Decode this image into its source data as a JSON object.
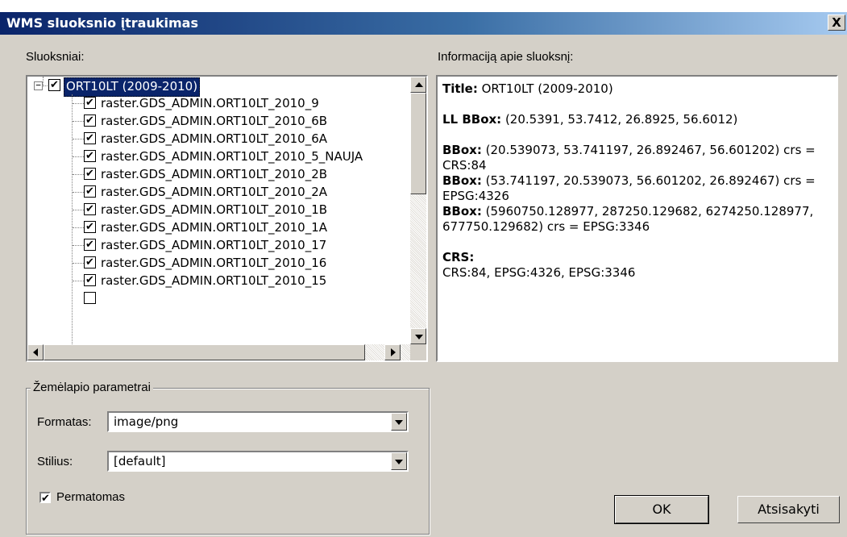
{
  "window": {
    "title": "WMS sluoksnio įtraukimas",
    "close_label": "X"
  },
  "layers": {
    "label": "Sluoksniai:",
    "root": {
      "label": "ORT10LT (2009-2010)",
      "checked": "✔",
      "expander": "−"
    },
    "items": [
      "raster.GDS_ADMIN.ORT10LT_2010_9",
      "raster.GDS_ADMIN.ORT10LT_2010_6B",
      "raster.GDS_ADMIN.ORT10LT_2010_6A",
      "raster.GDS_ADMIN.ORT10LT_2010_5_NAUJA",
      "raster.GDS_ADMIN.ORT10LT_2010_2B",
      "raster.GDS_ADMIN.ORT10LT_2010_2A",
      "raster.GDS_ADMIN.ORT10LT_2010_1B",
      "raster.GDS_ADMIN.ORT10LT_2010_1A",
      "raster.GDS_ADMIN.ORT10LT_2010_17",
      "raster.GDS_ADMIN.ORT10LT_2010_16",
      "raster.GDS_ADMIN.ORT10LT_2010_15"
    ],
    "check_mark": "✔"
  },
  "info": {
    "label": "Informaciją apie sluoksnį:",
    "title_key": "Title:",
    "title_val": " ORT10LT (2009-2010)",
    "llbbox_key": "LL BBox:",
    "llbbox_val": " (20.5391, 53.7412, 26.8925, 56.6012)",
    "bbox1_key": "BBox:",
    "bbox1_val": " (20.539073, 53.741197, 26.892467, 56.601202) crs = CRS:84",
    "bbox2_key": "BBox:",
    "bbox2_val": " (53.741197, 20.539073, 56.601202, 26.892467) crs = EPSG:4326",
    "bbox3_key": "BBox:",
    "bbox3_val": " (5960750.128977, 287250.129682, 6274250.128977, 677750.129682) crs = EPSG:3346",
    "crs_key": "CRS:",
    "crs_val": "CRS:84, EPSG:4326, EPSG:3346"
  },
  "map_params": {
    "group_label": "Žemėlapio parametrai",
    "format_label": "Formatas:",
    "format_value": "image/png",
    "style_label": "Stilius:",
    "style_value": "[default]",
    "transparent_label": "Permatomas",
    "transparent_checked": "✔"
  },
  "buttons": {
    "ok": "OK",
    "cancel": "Atsisakyti"
  }
}
